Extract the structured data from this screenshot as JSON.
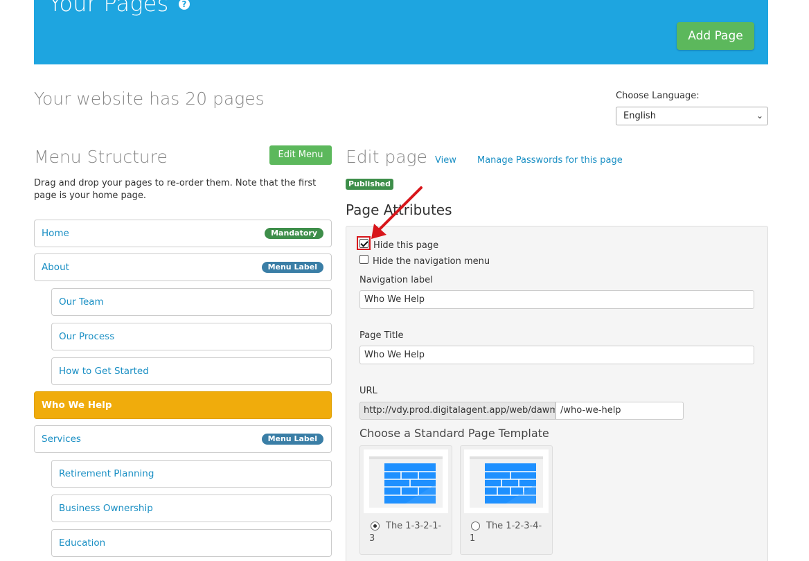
{
  "header": {
    "title": "Your Pages",
    "help_icon": "?",
    "add_page_label": "Add Page"
  },
  "summary": {
    "page_count_text": "Your website has 20 pages"
  },
  "language": {
    "label": "Choose Language:",
    "selected": "English"
  },
  "menu": {
    "title": "Menu Structure",
    "edit_label": "Edit Menu",
    "description": "Drag and drop your pages to re-order them. Note that the first page is your home page.",
    "items": [
      {
        "label": "Home",
        "badge": "Mandatory"
      },
      {
        "label": "About",
        "badge": "Menu Label"
      },
      {
        "label": "Our Team"
      },
      {
        "label": "Our Process"
      },
      {
        "label": "How to Get Started"
      },
      {
        "label": "Who We Help"
      },
      {
        "label": "Services",
        "badge": "Menu Label"
      },
      {
        "label": "Retirement Planning"
      },
      {
        "label": "Business Ownership"
      },
      {
        "label": "Education"
      }
    ]
  },
  "edit": {
    "title": "Edit page",
    "view_link": "View",
    "manage_link": "Manage Passwords for this page",
    "status_badge": "Published",
    "attributes_title": "Page Attributes",
    "hide_page_label": "Hide this page",
    "hide_page_checked": true,
    "hide_nav_label": "Hide the navigation menu",
    "hide_nav_checked": false,
    "nav_label_title": "Navigation label",
    "nav_label_value": "Who We Help",
    "page_title_label": "Page Title",
    "page_title_value": "Who We Help",
    "url_label": "URL",
    "url_prefix": "http://vdy.prod.digitalagent.app/web/dawmg",
    "url_slug": "/who-we-help",
    "template_heading": "Choose a Standard Page Template",
    "templates": [
      {
        "label_line1": "The 1-3-2-1-",
        "label_line2": "3",
        "selected": true
      },
      {
        "label_line1": "The 1-2-3-4-",
        "label_line2": "1",
        "selected": false
      }
    ]
  },
  "colors": {
    "banner": "#1ea5e0",
    "primary_button": "#5cb85c",
    "active_item": "#f0ac0c",
    "link": "#1a8fc4",
    "annotation": "#d8161b"
  }
}
